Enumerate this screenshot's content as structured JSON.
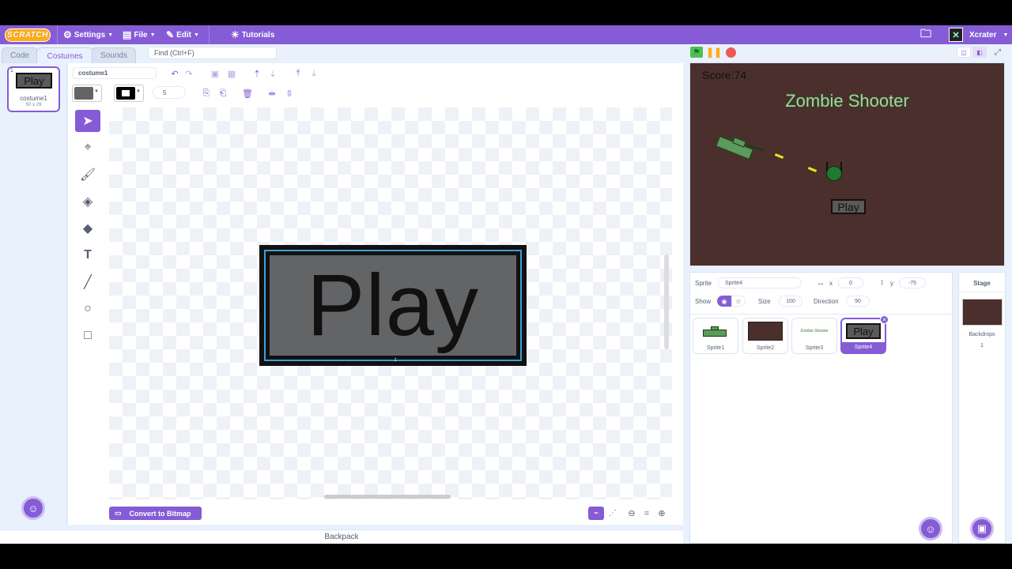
{
  "menubar": {
    "logo": "SCRATCH",
    "settings": "Settings",
    "file": "File",
    "edit": "Edit",
    "tutorials": "Tutorials",
    "username": "Xcrater"
  },
  "tabs": {
    "code": "Code",
    "costumes": "Costumes",
    "sounds": "Sounds"
  },
  "find_placeholder": "Find (Ctrl+F)",
  "costume_list": {
    "items": [
      {
        "number": "1",
        "name": "costume1",
        "size": "50 x 29",
        "thumb_text": "Play"
      }
    ]
  },
  "editor": {
    "costume_name": "costume1",
    "outline_width": "5",
    "canvas_text": "Play",
    "convert_button": "Convert to Bitmap",
    "fill_color": "#636466",
    "outline_color": "#000000"
  },
  "backpack": "Backpack",
  "stage": {
    "score": "Score:74",
    "title": "Zombie Shooter",
    "play_button": "Play",
    "background": "#4a2f2d"
  },
  "sprite_info": {
    "sprite_label": "Sprite",
    "sprite_name": "Sprite4",
    "x_label": "x",
    "x_value": "0",
    "y_label": "y",
    "y_value": "-75",
    "show_label": "Show",
    "size_label": "Size",
    "size_value": "100",
    "direction_label": "Direction",
    "direction_value": "90"
  },
  "sprites": [
    {
      "name": "Sprite1"
    },
    {
      "name": "Sprite2"
    },
    {
      "name": "Sprite3",
      "thumb_text": "Zombie Shooter"
    },
    {
      "name": "Sprite4",
      "thumb_text": "Play"
    }
  ],
  "stage_pane": {
    "title": "Stage",
    "backdrops_label": "Backdrops",
    "backdrops_count": "1"
  },
  "colors": {
    "accent": "#855cd6",
    "menubar": "#855cd6",
    "logo": "#ffab19",
    "green_flag": "#4cbf56",
    "stop": "#ec5959"
  }
}
